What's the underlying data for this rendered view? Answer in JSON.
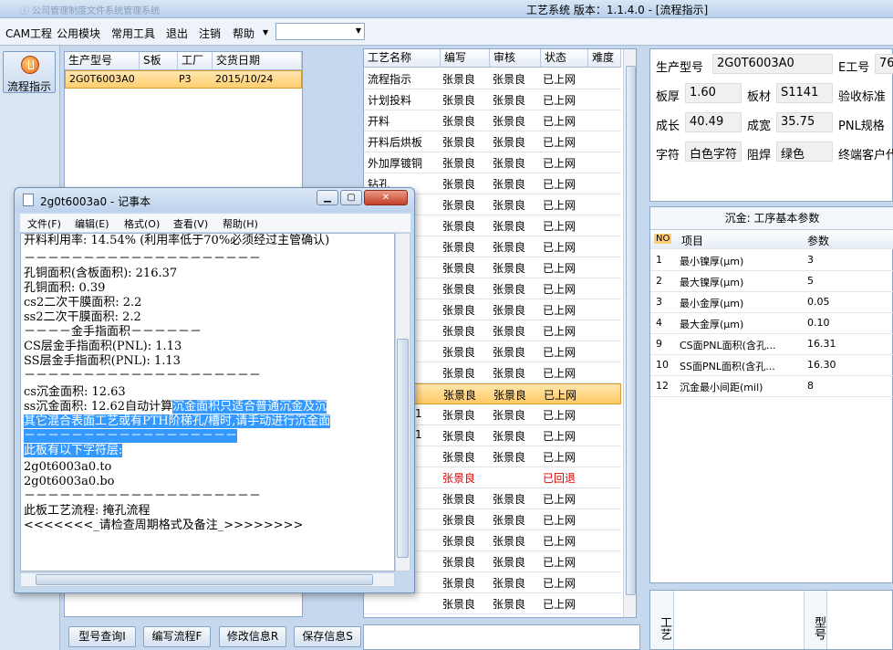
{
  "window": {
    "title": "工艺系统   版本：1.1.4.0 - [流程指示]",
    "ghost_title": "ⓘ 公司管理制度文件系统管理系统"
  },
  "menu": {
    "items": [
      "CAM工程",
      "公用模块",
      "常用工具",
      "退出",
      "注销",
      "帮助"
    ],
    "combo_value": ""
  },
  "leftbar": {
    "flow_button": "流程指示"
  },
  "orders": {
    "headers": [
      "生产型号",
      "S板",
      "工厂",
      "交货日期"
    ],
    "rows": [
      {
        "model": "2G0T6003A0",
        "s_board": "",
        "factory": "P3",
        "date": "2015/10/24"
      }
    ]
  },
  "process": {
    "headers": [
      "工艺名称",
      "编写",
      "审核",
      "状态",
      "难度"
    ],
    "rows": [
      {
        "name": "流程指示",
        "writer": "张景良",
        "reviewer": "张景良",
        "status": "已上网"
      },
      {
        "name": "计划投料",
        "writer": "张景良",
        "reviewer": "张景良",
        "status": "已上网"
      },
      {
        "name": "开料",
        "writer": "张景良",
        "reviewer": "张景良",
        "status": "已上网"
      },
      {
        "name": "开料后烘板",
        "writer": "张景良",
        "reviewer": "张景良",
        "status": "已上网"
      },
      {
        "name": "外加厚镀铜",
        "writer": "张景良",
        "reviewer": "张景良",
        "status": "已上网"
      },
      {
        "name": "钻孔",
        "writer": "张景良",
        "reviewer": "张景良",
        "status": "已上网"
      },
      {
        "name": "",
        "writer": "张景良",
        "reviewer": "张景良",
        "status": "已上网"
      },
      {
        "name": "",
        "writer": "张景良",
        "reviewer": "张景良",
        "status": "已上网"
      },
      {
        "name": "",
        "writer": "张景良",
        "reviewer": "张景良",
        "status": "已上网"
      },
      {
        "name": "",
        "writer": "张景良",
        "reviewer": "张景良",
        "status": "已上网"
      },
      {
        "name": "",
        "writer": "张景良",
        "reviewer": "张景良",
        "status": "已上网"
      },
      {
        "name": "",
        "writer": "张景良",
        "reviewer": "张景良",
        "status": "已上网"
      },
      {
        "name": "",
        "writer": "张景良",
        "reviewer": "张景良",
        "status": "已上网"
      },
      {
        "name": "",
        "writer": "张景良",
        "reviewer": "张景良",
        "status": "已上网"
      },
      {
        "name": "",
        "writer": "张景良",
        "reviewer": "张景良",
        "status": "已上网"
      },
      {
        "name": "",
        "writer": "张景良",
        "reviewer": "张景良",
        "status": "已上网"
      },
      {
        "name": "",
        "writer": "张景良",
        "reviewer": "张景良",
        "status": "已上网"
      },
      {
        "name": "",
        "writer": "张景良",
        "reviewer": "张景良",
        "status": "已上网"
      },
      {
        "name": "",
        "writer": "张景良",
        "reviewer": "张景良",
        "status": "已上网"
      },
      {
        "name": "",
        "writer": "张景良",
        "reviewer": "",
        "status": "已回退"
      },
      {
        "name": "",
        "writer": "张景良",
        "reviewer": "张景良",
        "status": "已上网"
      },
      {
        "name": "",
        "writer": "张景良",
        "reviewer": "张景良",
        "status": "已上网"
      },
      {
        "name": "",
        "writer": "张景良",
        "reviewer": "张景良",
        "status": "已上网"
      },
      {
        "name": "",
        "writer": "张景良",
        "reviewer": "张景良",
        "status": "已上网"
      },
      {
        "name": "",
        "writer": "张景良",
        "reviewer": "张景良",
        "status": "已上网"
      },
      {
        "name": "",
        "writer": "张景良",
        "reviewer": "张景良",
        "status": "已上网"
      },
      {
        "name": "包装",
        "writer": "张景良",
        "reviewer": "张景良",
        "status": "已上网"
      }
    ],
    "partial_suffix": "1"
  },
  "info": {
    "model_label": "生产型号",
    "model": "2G0T6003A0",
    "eng_label": "E工号",
    "eng": "76",
    "thick_label": "板厚",
    "thick": "1.60",
    "material_label": "板材",
    "material": "S1141",
    "accept_label": "验收标准",
    "length_label": "成长",
    "length": "40.49",
    "width_label": "成宽",
    "width": "35.75",
    "pnl_label": "PNL规格",
    "char_label": "字符",
    "char": "白色字符",
    "mask_label": "阻焊",
    "mask": "绿色",
    "customer_label": "终端客户代"
  },
  "params": {
    "title": "沉金: 工序基本参数",
    "headers": [
      "NO",
      "项目",
      "参数"
    ],
    "rows": [
      {
        "no": "1",
        "item": "最小镍厚(μm)",
        "val": "3"
      },
      {
        "no": "2",
        "item": "最大镍厚(μm)",
        "val": "5"
      },
      {
        "no": "3",
        "item": "最小金厚(μm)",
        "val": "0.05"
      },
      {
        "no": "4",
        "item": "最大金厚(μm)",
        "val": "0.10"
      },
      {
        "no": "9",
        "item": "CS面PNL面积(含孔...",
        "val": "16.31"
      },
      {
        "no": "10",
        "item": "SS面PNL面积(含孔...",
        "val": "16.30"
      },
      {
        "no": "12",
        "item": "沉金最小间距(mil)",
        "val": "8"
      }
    ]
  },
  "bottom_right": {
    "col1": "工艺",
    "col2": "型号"
  },
  "buttons": [
    "型号查询I",
    "编写流程F",
    "修改信息R",
    "保存信息S"
  ],
  "notepad": {
    "title": "2g0t6003a0 - 记事本",
    "menu": [
      "文件(F)",
      "编辑(E)",
      "格式(O)",
      "查看(V)",
      "帮助(H)"
    ],
    "lines": [
      {
        "t": "开料利用率: 14.54% (利用率低于70%必须经过主管确认)"
      },
      {
        "t": "－－－－－－－－－－－－－－－－－－－－"
      },
      {
        "t": "孔铜面积(含板面积): 216.37"
      },
      {
        "t": "孔铜面积: 0.39"
      },
      {
        "t": "cs2二次干膜面积: 2.2"
      },
      {
        "t": "ss2二次干膜面积: 2.2"
      },
      {
        "t": "－－－－金手指面积－－－－－－"
      },
      {
        "t": "CS层金手指面积(PNL): 1.13"
      },
      {
        "t": "SS层金手指面积(PNL): 1.13"
      },
      {
        "t": "－－－－－－－－－－－－－－－－－－－－"
      },
      {
        "t": "cs沉金面积: 12.63"
      },
      {
        "t": "ss沉金面积: 12.62自动计算",
        "h": "沉金面积只适合普通沉金及沉"
      },
      {
        "t": "",
        "h": "其它混合表面工艺或有PTH阶梯孔/槽时,请手动进行沉金面"
      },
      {
        "t": "",
        "h": "－－－－－－－－－－－－－－－－－－"
      },
      {
        "t": "",
        "h": "此板有以下字符层:"
      },
      {
        "t": "2g0t6003a0.to"
      },
      {
        "t": "2g0t6003a0.bo"
      },
      {
        "t": "－－－－－－－－－－－－－－－－－－－－"
      },
      {
        "t": "此板工艺流程: 掩孔流程"
      },
      {
        "t": "<<<<<<<_请检查周期格式及备注_>>>>>>>>"
      }
    ]
  },
  "colors": {
    "selection": "#ffc964",
    "returned": "#e00000",
    "highlight": "#3399ff"
  }
}
